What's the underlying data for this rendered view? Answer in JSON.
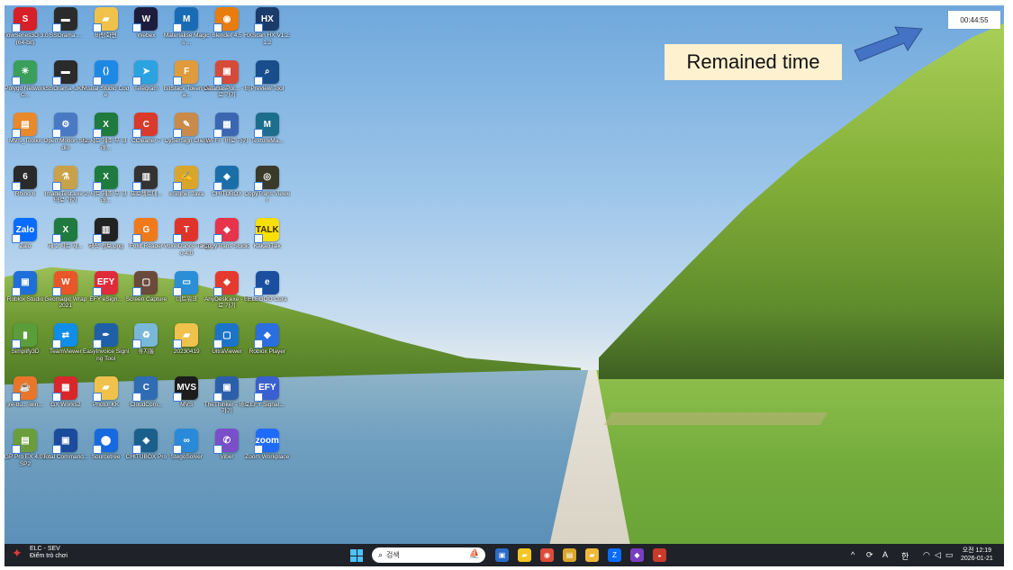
{
  "overlay": {
    "timer": "00:44:55",
    "callout": "Remained time"
  },
  "colors": {
    "callout_bg": "#fdf1cf",
    "arrow": "#4472c4",
    "taskbar_bg": "#1f2228",
    "windows_blue": "#4cc2ff"
  },
  "desktop_icons": [
    {
      "label": "FlowSeries3D 3.0 (64-bit)",
      "icon": "flow-icon",
      "color": "#d61f26",
      "glyph": "S"
    },
    {
      "label": "SSOrama ...",
      "icon": "monitor-icon",
      "color": "#2b2b2b",
      "glyph": "▬"
    },
    {
      "label": "바탕화면",
      "icon": "folder-icon",
      "color": "#f0c24b",
      "glyph": "▰"
    },
    {
      "label": "Webex",
      "icon": "webex-icon",
      "color": "#1d1d3b",
      "glyph": "W"
    },
    {
      "label": "Materialise Magics ...",
      "icon": "magics-icon",
      "color": "#1a6bb5",
      "glyph": "M"
    },
    {
      "label": "Blender 4.5",
      "icon": "blender-icon",
      "color": "#e87d0d",
      "glyph": "◉"
    },
    {
      "label": "HXScan HX V1.2.1.2",
      "icon": "hx-icon",
      "color": "#1b3c6b",
      "glyph": "HX"
    },
    {
      "label": "Polygo Network C...",
      "icon": "polygon-icon",
      "color": "#3a9f5a",
      "glyph": "✳"
    },
    {
      "label": "SSOrama_JKH",
      "icon": "monitor-icon",
      "color": "#2b2b2b",
      "glyph": "▬"
    },
    {
      "label": "Visual Studio Code",
      "icon": "vscode-icon",
      "color": "#1e88e5",
      "glyph": "⟨⟩"
    },
    {
      "label": "Telegram",
      "icon": "telegram-icon",
      "color": "#2aa3e0",
      "glyph": "➤"
    },
    {
      "label": "BitStack Token Wa...",
      "icon": "token-icon",
      "color": "#e09b3d",
      "glyph": "F"
    },
    {
      "label": "DataBasPol... - 바로 가기",
      "icon": "cube-icon",
      "color": "#d64a3a",
      "glyph": "▣"
    },
    {
      "label": "Preview Tool",
      "icon": "preview-icon",
      "color": "#1a4d8c",
      "glyph": "⌕"
    },
    {
      "label": "MVS_Toolkit",
      "icon": "toolbox-icon",
      "color": "#e8892b",
      "glyph": "▤"
    },
    {
      "label": "Open Motion Studio",
      "icon": "motion-icon",
      "color": "#4a79c4",
      "glyph": "⚙"
    },
    {
      "label": "2.시트 제조 부 크래...",
      "icon": "excel-icon",
      "color": "#1f7a3f",
      "glyph": "X"
    },
    {
      "label": "CCleaner 7",
      "icon": "ccleaner-icon",
      "color": "#d93a2b",
      "glyph": "C"
    },
    {
      "label": "CySerSign Client",
      "icon": "sign-icon",
      "color": "#c98a4a",
      "glyph": "✎"
    },
    {
      "label": "Wi-Fi - 바로 가기",
      "icon": "wifi-tool-icon",
      "color": "#3c67b0",
      "glyph": "▦"
    },
    {
      "label": "TextureMa...",
      "icon": "texture-icon",
      "color": "#1c6e8c",
      "glyph": "M"
    },
    {
      "label": "Rhino 6",
      "icon": "rhino-icon",
      "color": "#2a2a2a",
      "glyph": "6"
    },
    {
      "label": "ImageTest.exe - 바로 가기",
      "icon": "microscope-icon",
      "color": "#c8a24a",
      "glyph": "⚗"
    },
    {
      "label": "2.시트 제조 부 크래...",
      "icon": "excel-icon",
      "color": "#1f7a3f",
      "glyph": "X"
    },
    {
      "label": "프로젝트데...",
      "icon": "barcode-icon",
      "color": "#333333",
      "glyph": "▥"
    },
    {
      "label": "eSigner Java",
      "icon": "esigner-icon",
      "color": "#d9a62b",
      "glyph": "✍"
    },
    {
      "label": "CHITUBOX",
      "icon": "chitubox-icon",
      "color": "#1b6fa8",
      "glyph": "◈"
    },
    {
      "label": "CopyTrans Viewer",
      "icon": "copytrans-icon",
      "color": "#3a3a2a",
      "glyph": "◎"
    },
    {
      "label": "Zalo",
      "icon": "zalo-icon",
      "color": "#0a6cff",
      "glyph": "Zalo"
    },
    {
      "label": "제 2.시트 제...",
      "icon": "excel-icon",
      "color": "#1f7a3f",
      "glyph": "X"
    },
    {
      "label": "제작 정보.png",
      "icon": "image-file-icon",
      "color": "#222222",
      "glyph": "▥"
    },
    {
      "label": "Foxit Reader",
      "icon": "foxit-icon",
      "color": "#f07a1a",
      "glyph": "G"
    },
    {
      "label": "VoxelDance Tango 4.0",
      "icon": "voxel-icon",
      "color": "#e0342b",
      "glyph": "T"
    },
    {
      "label": "CopyTrans Studio",
      "icon": "copytrans-studio-icon",
      "color": "#e8334d",
      "glyph": "◆"
    },
    {
      "label": "KakaoTalk",
      "icon": "kakao-icon",
      "color": "#f9e000",
      "glyph": "TALK"
    },
    {
      "label": "Roblox Studio",
      "icon": "roblox-studio-icon",
      "color": "#1e6fd9",
      "glyph": "▣"
    },
    {
      "label": "Geomagic Wrap 2021",
      "icon": "geomagic-icon",
      "color": "#e8562a",
      "glyph": "W"
    },
    {
      "label": "EFY eSign...",
      "icon": "efy-icon",
      "color": "#e02b3a",
      "glyph": "EFY"
    },
    {
      "label": "Screen Capture",
      "icon": "capture-icon",
      "color": "#6a4a3a",
      "glyph": "▢"
    },
    {
      "label": "네트워크",
      "icon": "network-icon",
      "color": "#2a8fd6",
      "glyph": "▭"
    },
    {
      "label": "AnyDesk.exe - 바로 가기",
      "icon": "anydesk-icon",
      "color": "#e63a2e",
      "glyph": "◆"
    },
    {
      "label": "ELEGOO Cura",
      "icon": "cura-icon",
      "color": "#1a4fa0",
      "glyph": "e"
    },
    {
      "label": "Simplify3D",
      "icon": "simplify-icon",
      "color": "#5a9e3a",
      "glyph": "▮"
    },
    {
      "label": "TeamViewer",
      "icon": "teamviewer-icon",
      "color": "#0e8ee9",
      "glyph": "⇄"
    },
    {
      "label": "EasyInvoice Signing Tool",
      "icon": "invoice-icon",
      "color": "#1f5fa8",
      "glyph": "✒"
    },
    {
      "label": "휴지통",
      "icon": "recycle-bin-icon",
      "color": "#7ab8d9",
      "glyph": "♻"
    },
    {
      "label": "20230419",
      "icon": "folder-icon",
      "color": "#f0c24b",
      "glyph": "▰"
    },
    {
      "label": "UltraViewer",
      "icon": "ultraviewer-icon",
      "color": "#1c74c9",
      "glyph": "▢"
    },
    {
      "label": "Roblox Player",
      "icon": "roblox-icon",
      "color": "#2a6ee0",
      "glyph": "◆"
    },
    {
      "label": "jre-8u...-win...",
      "icon": "java-icon",
      "color": "#e8762a",
      "glyph": "☕"
    },
    {
      "label": "GX Works2",
      "icon": "gxworks-icon",
      "color": "#d9262b",
      "glyph": "▦"
    },
    {
      "label": "Photo_KK",
      "icon": "folder-icon",
      "color": "#f0c24b",
      "glyph": "▰"
    },
    {
      "label": "CloudCom...",
      "icon": "cloudcom-icon",
      "color": "#2f6cb3",
      "glyph": "C"
    },
    {
      "label": "MVS",
      "icon": "mvs-icon",
      "color": "#1c1c1c",
      "glyph": "MVS"
    },
    {
      "label": "TheThinker - 바로 가기",
      "icon": "thinker-icon",
      "color": "#2b5faa",
      "glyph": "▣"
    },
    {
      "label": "EFY Signat...",
      "icon": "efy-icon",
      "color": "#3a5fcf",
      "glyph": "EFY"
    },
    {
      "label": "GP Pro EX 4.09 SP2",
      "icon": "gppro-icon",
      "color": "#6a9e3a",
      "glyph": "▤"
    },
    {
      "label": "Total Command...",
      "icon": "floppy-icon",
      "color": "#1b4b9c",
      "glyph": "▣"
    },
    {
      "label": "Sourcetree",
      "icon": "sourcetree-icon",
      "color": "#1769e0",
      "glyph": "⬤"
    },
    {
      "label": "CHITUBOX Pro",
      "icon": "chitubox-icon",
      "color": "#1b5f8c",
      "glyph": "◈"
    },
    {
      "label": "StegoSolver",
      "icon": "infinity-icon",
      "color": "#2a8ad9",
      "glyph": "∞"
    },
    {
      "label": "Viber",
      "icon": "viber-icon",
      "color": "#7a4fc9",
      "glyph": "✆"
    },
    {
      "label": "Zoom Workplace",
      "icon": "zoom-icon",
      "color": "#1f6bff",
      "glyph": "zoom"
    }
  ],
  "taskbar": {
    "weather_title": "ELC - SEV",
    "weather_sub": "Điểm trò chơi",
    "search_placeholder": "검색",
    "apps": [
      {
        "name": "taskbar-app-widgets",
        "icon": "widgets-icon",
        "color": "#2b6cc9",
        "glyph": "▣"
      },
      {
        "name": "taskbar-app-notes",
        "icon": "sticky-notes-icon",
        "color": "#f3c623",
        "glyph": "▰"
      },
      {
        "name": "taskbar-app-chrome",
        "icon": "chrome-icon",
        "color": "#dd4b39",
        "glyph": "◉"
      },
      {
        "name": "taskbar-app-pdf",
        "icon": "pdf-icon",
        "color": "#d9a62b",
        "glyph": "▤"
      },
      {
        "name": "taskbar-app-explorer",
        "icon": "file-explorer-icon",
        "color": "#f0b83a",
        "glyph": "▰"
      },
      {
        "name": "taskbar-app-zalo",
        "icon": "zalo-icon",
        "color": "#0a6cff",
        "glyph": "Z"
      },
      {
        "name": "taskbar-app-vs",
        "icon": "visual-studio-icon",
        "color": "#7a3fc0",
        "glyph": "◆"
      },
      {
        "name": "taskbar-app-cooking",
        "icon": "pot-icon",
        "color": "#c83a2b",
        "glyph": "◒"
      }
    ],
    "tray": {
      "chevron": "^",
      "lang_a": "A",
      "lang_han": "한"
    },
    "clock_time": "오전 12:19",
    "clock_date": "2026-01-21"
  }
}
